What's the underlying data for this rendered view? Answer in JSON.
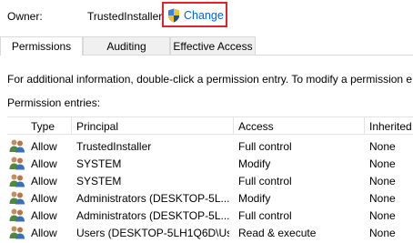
{
  "owner": {
    "label": "Owner:",
    "value": "TrustedInstaller",
    "change_label": "Change"
  },
  "tabs": [
    {
      "label": "Permissions",
      "active": true
    },
    {
      "label": "Auditing",
      "active": false
    },
    {
      "label": "Effective Access",
      "active": false
    }
  ],
  "info_text": "For additional information, double-click a permission entry. To modify a permission e",
  "entries_label": "Permission entries:",
  "table": {
    "headers": {
      "type": "Type",
      "principal": "Principal",
      "access": "Access",
      "inherited": "Inherited"
    },
    "rows": [
      {
        "type": "Allow",
        "principal": "TrustedInstaller",
        "access": "Full control",
        "inherited": "None"
      },
      {
        "type": "Allow",
        "principal": "SYSTEM",
        "access": "Modify",
        "inherited": "None"
      },
      {
        "type": "Allow",
        "principal": "SYSTEM",
        "access": "Full control",
        "inherited": "None"
      },
      {
        "type": "Allow",
        "principal": "Administrators (DESKTOP-5L...",
        "access": "Modify",
        "inherited": "None"
      },
      {
        "type": "Allow",
        "principal": "Administrators (DESKTOP-5L...",
        "access": "Full control",
        "inherited": "None"
      },
      {
        "type": "Allow",
        "principal": "Users (DESKTOP-5LH1Q6D\\Us...",
        "access": "Read & execute",
        "inherited": "None"
      }
    ]
  },
  "colors": {
    "link": "#0066cc",
    "highlight_box": "#e0242b"
  }
}
